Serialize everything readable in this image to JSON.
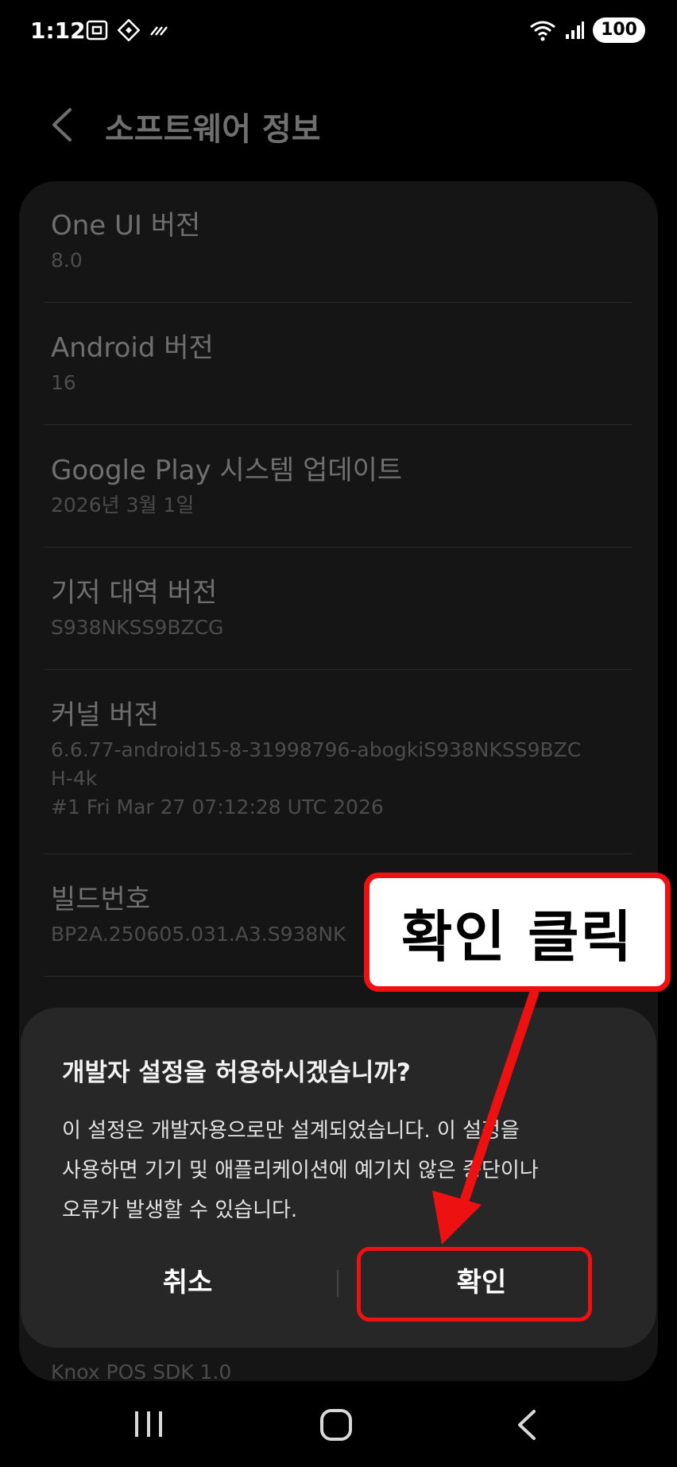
{
  "status_bar": {
    "time": "1:12",
    "battery": "100"
  },
  "header": {
    "title": "소프트웨어 정보"
  },
  "items": [
    {
      "title": "One UI 버전",
      "value": "8.0"
    },
    {
      "title": "Android 버전",
      "value": "16"
    },
    {
      "title": "Google Play 시스템 업데이트",
      "value": "2026년 3월 1일"
    },
    {
      "title": "기저 대역 버전",
      "value": "S938NKSS9BZCG"
    },
    {
      "title": "커널 버전",
      "value_lines": [
        "6.6.77-android15-8-31998796-abogkiS938NKSS9BZC",
        "H-4k",
        "#1 Fri Mar 27 07:12:28 UTC 2026"
      ]
    },
    {
      "title": "빌드번호",
      "value": "BP2A.250605.031.A3.S938NK"
    }
  ],
  "footer_peek": "Knox POS SDK 1.0",
  "dialog": {
    "title": "개발자 설정을 허용하시겠습니까?",
    "body_lines": [
      "이 설정은 개발자용으로만 설계되었습니다. 이 설정을",
      "사용하면 기기 및 애플리케이션에 예기치 않은 중단이나",
      "오류가 발생할 수 있습니다."
    ],
    "cancel_label": "취소",
    "confirm_label": "확인"
  },
  "callout": {
    "text": "확인 클릭"
  },
  "colors": {
    "background": "#000000",
    "card": "#151515",
    "dialog": "#272727",
    "annotation_red": "#ee1111"
  },
  "icons": {
    "back": "chevron-left-icon",
    "screenshot": "screenshot-icon",
    "nfc": "nfc-icon",
    "wifi": "wifi-icon",
    "signal": "signal-icon",
    "recents": "recents-icon",
    "home": "home-icon",
    "nav_back": "nav-back-icon"
  }
}
